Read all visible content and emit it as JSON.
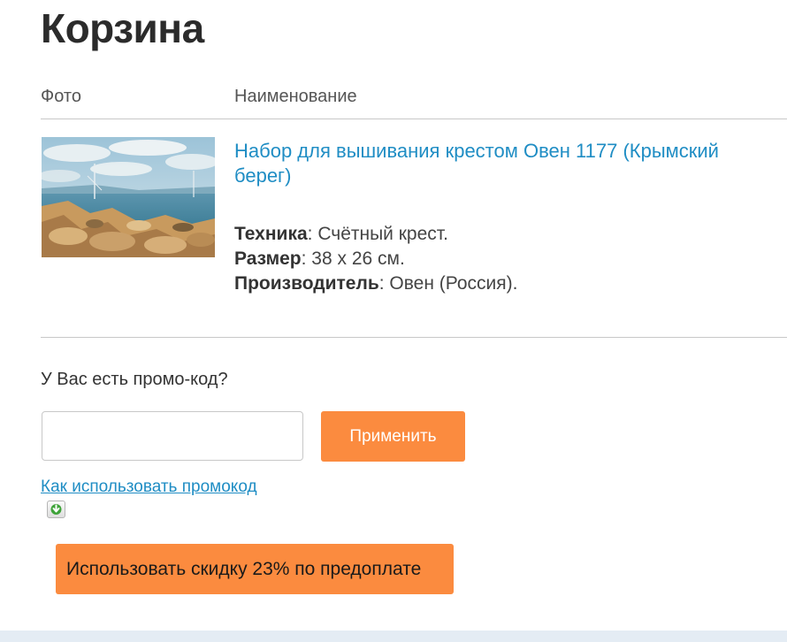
{
  "page": {
    "title": "Корзина"
  },
  "cart_table": {
    "headers": {
      "photo": "Фото",
      "name": "Наименование"
    },
    "items": [
      {
        "name": "Набор для вышивания крестом Овен 1177 (Крымский берег)",
        "properties": [
          {
            "label": "Техника",
            "value": ": Счётный крест."
          },
          {
            "label": "Размер",
            "value": ": 38 х 26 см."
          },
          {
            "label": "Производитель",
            "value": ": Овен (Россия)."
          }
        ]
      }
    ]
  },
  "promo": {
    "question": "У Вас есть промо-код?",
    "input_value": "",
    "input_placeholder": "",
    "apply_label": "Применить",
    "help_link": "Как использовать промокод",
    "help_icon": "download-arrow-icon"
  },
  "discount": {
    "label": "Использовать скидку 23% по предоплате"
  },
  "colors": {
    "accent_orange": "#fb8b3f",
    "link_blue": "#1f8dc4",
    "footer_strip": "#e4ecf4"
  }
}
